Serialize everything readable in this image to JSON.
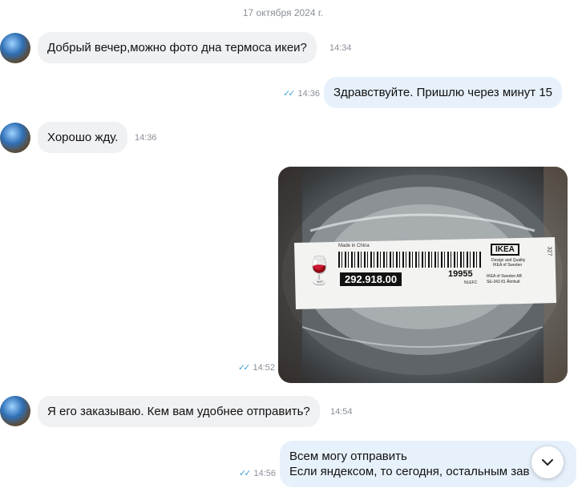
{
  "chat": {
    "date_label": "17 октября 2024 г.",
    "messages": [
      {
        "dir": "in",
        "text": "Добрый вечер,можно фото дна термоса икеи?",
        "time": "14:34"
      },
      {
        "dir": "out",
        "text": "Здравствуйте. Пришлю через минут 15",
        "time": "14:36",
        "read": true
      },
      {
        "dir": "in",
        "text": "Хорошо жду.",
        "time": "14:36"
      },
      {
        "dir": "out",
        "type": "photo",
        "time": "14:52",
        "read": true
      },
      {
        "dir": "in",
        "text": "Я его заказываю. Кем вам удобнее отправить?",
        "time": "14:54"
      },
      {
        "dir": "out",
        "text_lines": [
          "Всем могу отправить",
          "Если яндексом, то сегодня, остальным зав"
        ],
        "time": "14:56",
        "read": true
      }
    ]
  },
  "photo_label": {
    "made_in": "Made in China",
    "article": "292.918.00",
    "code": "19955",
    "code2": "NLEFC",
    "brand": "IKEA",
    "brand_note1": "Design and Quality",
    "brand_note2": "IKEA of Sweden",
    "address1": "IKEA of Sweden AB",
    "address2": "SE-343 81 Älmhult",
    "side_text": "327"
  },
  "icons": {
    "checks": "double-check-icon",
    "scroll": "chevron-down-icon"
  }
}
